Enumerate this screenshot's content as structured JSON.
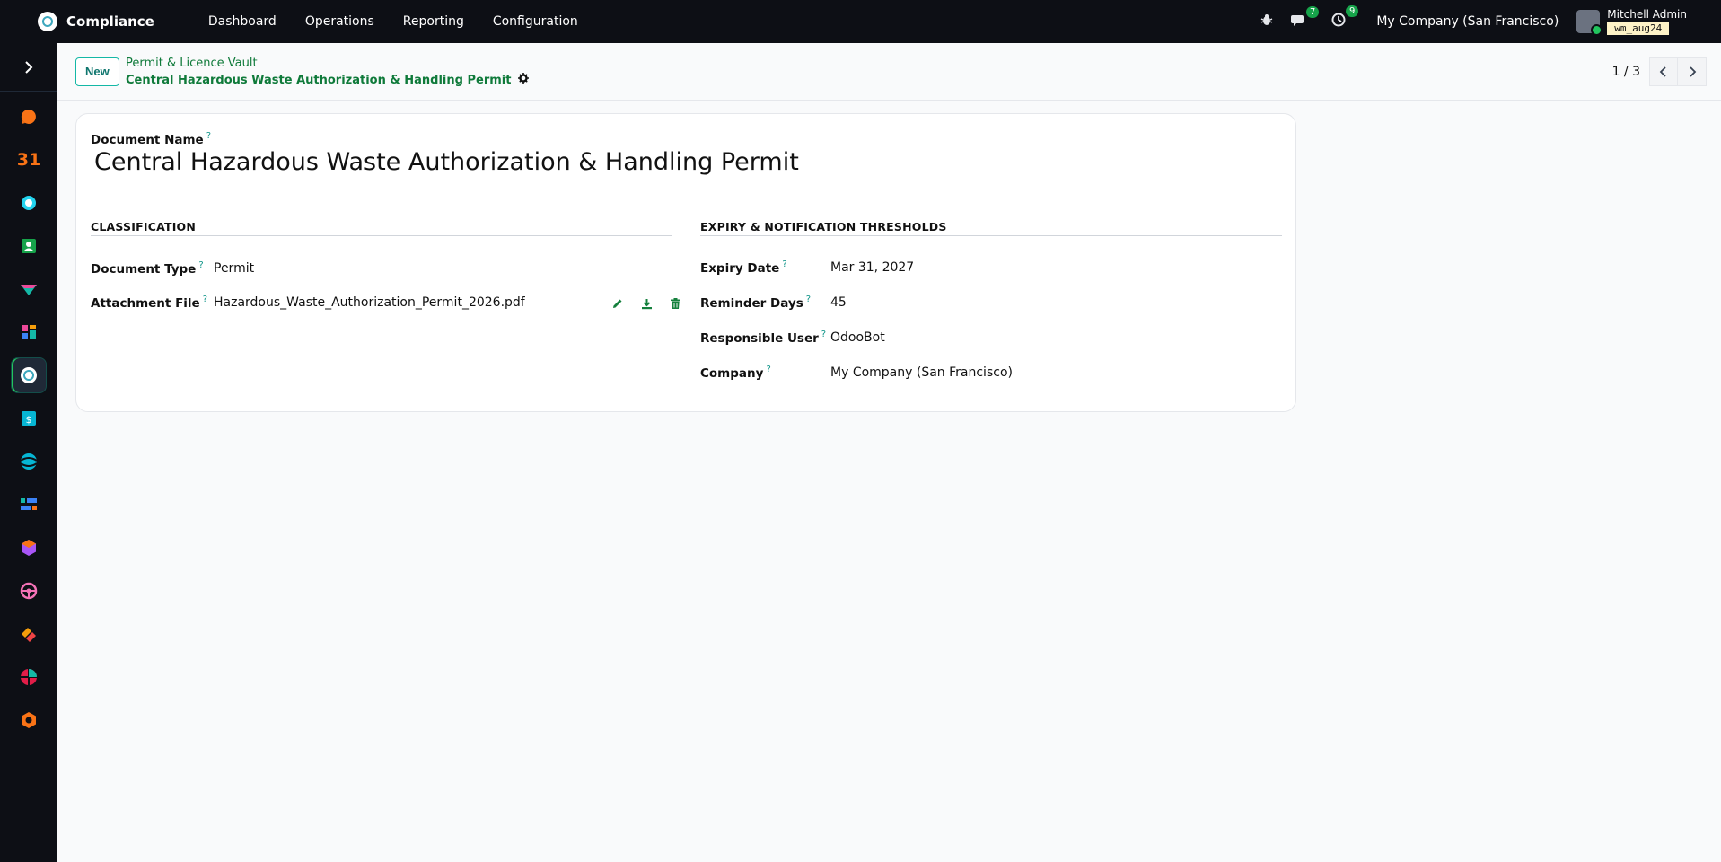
{
  "nav": {
    "app_name": "Compliance",
    "menu": [
      "Dashboard",
      "Operations",
      "Reporting",
      "Configuration"
    ],
    "messages_count": "7",
    "activities_count": "9",
    "company": "My Company (San Francisco)",
    "user_name": "Mitchell Admin",
    "db_name": "wm_aug24"
  },
  "sidebar": {
    "apps": [
      {
        "icon": "discuss-icon",
        "color": "#f97316"
      },
      {
        "icon": "calendar-icon",
        "text": "31",
        "color": "#f97316"
      },
      {
        "icon": "helpdesk-icon",
        "color": "#22d3ee"
      },
      {
        "icon": "contacts-icon",
        "color": "#16a34a"
      },
      {
        "icon": "crm-icon",
        "color": "#14b8a6"
      },
      {
        "icon": "dashboards-icon",
        "color": "#ec4899"
      },
      {
        "icon": "compliance-icon",
        "color": "#ffffff",
        "active": true
      },
      {
        "icon": "expenses-icon",
        "color": "#06b6d4"
      },
      {
        "icon": "website-icon",
        "color": "#06b6d4"
      },
      {
        "icon": "project-icon",
        "color": "#3b82f6"
      },
      {
        "icon": "inventory-icon",
        "color": "#a855f7"
      },
      {
        "icon": "fleet-icon",
        "color": "#f472b6"
      },
      {
        "icon": "tags-icon",
        "color": "#f59e0b"
      },
      {
        "icon": "surveys-icon",
        "color": "#e11d48"
      },
      {
        "icon": "apps-icon",
        "color": "#f97316"
      }
    ]
  },
  "control": {
    "new_label": "New",
    "breadcrumb_parent": "Permit & Licence Vault",
    "breadcrumb_current": "Central Hazardous Waste Authorization & Handling Permit",
    "pager": "1 / 3"
  },
  "form": {
    "name_label": "Document Name",
    "name_value": "Central Hazardous Waste Authorization & Handling Permit",
    "help_mark": "?",
    "classification": {
      "title": "CLASSIFICATION",
      "doc_type_label": "Document Type",
      "doc_type_value": "Permit",
      "attachment_label": "Attachment File",
      "attachment_value": "Hazardous_Waste_Authorization_Permit_2026.pdf"
    },
    "expiry": {
      "title": "EXPIRY & NOTIFICATION THRESHOLDS",
      "expiry_label": "Expiry Date",
      "expiry_value": "Mar 31, 2027",
      "reminder_label": "Reminder Days",
      "reminder_value": "45",
      "user_label": "Responsible User",
      "user_value": "OdooBot",
      "company_label": "Company",
      "company_value": "My Company (San Francisco)"
    }
  }
}
